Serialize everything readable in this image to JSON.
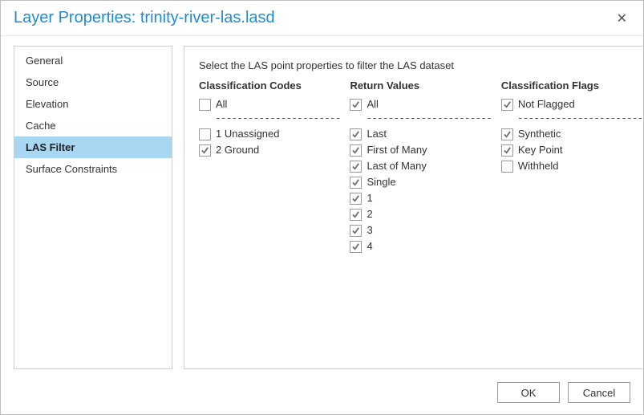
{
  "title": "Layer Properties: trinity-river-las.lasd",
  "sidebar": {
    "items": [
      {
        "label": "General",
        "active": false
      },
      {
        "label": "Source",
        "active": false
      },
      {
        "label": "Elevation",
        "active": false
      },
      {
        "label": "Cache",
        "active": false
      },
      {
        "label": "LAS Filter",
        "active": true
      },
      {
        "label": "Surface Constraints",
        "active": false
      }
    ]
  },
  "content": {
    "instruction": "Select the LAS point properties to filter the LAS dataset",
    "columns": [
      {
        "header": "Classification Codes",
        "groups": [
          [
            {
              "label": "All",
              "checked": false
            }
          ],
          [
            {
              "label": "1 Unassigned",
              "checked": false
            },
            {
              "label": "2 Ground",
              "checked": true
            }
          ]
        ]
      },
      {
        "header": "Return Values",
        "groups": [
          [
            {
              "label": "All",
              "checked": true
            }
          ],
          [
            {
              "label": "Last",
              "checked": true
            },
            {
              "label": "First of Many",
              "checked": true
            },
            {
              "label": "Last of Many",
              "checked": true
            },
            {
              "label": "Single",
              "checked": true
            },
            {
              "label": "1",
              "checked": true
            },
            {
              "label": "2",
              "checked": true
            },
            {
              "label": "3",
              "checked": true
            },
            {
              "label": "4",
              "checked": true
            }
          ]
        ]
      },
      {
        "header": "Classification Flags",
        "groups": [
          [
            {
              "label": "Not Flagged",
              "checked": true
            }
          ],
          [
            {
              "label": "Synthetic",
              "checked": true
            },
            {
              "label": "Key Point",
              "checked": true
            },
            {
              "label": "Withheld",
              "checked": false
            }
          ]
        ]
      }
    ]
  },
  "buttons": {
    "ok": "OK",
    "cancel": "Cancel"
  },
  "divider_glyph": "-----------------------"
}
